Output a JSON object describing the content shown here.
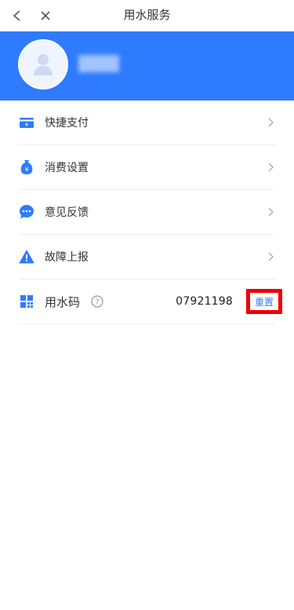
{
  "header": {
    "title": "用水服务",
    "back_icon": "back-arrow-icon",
    "close_icon": "close-icon"
  },
  "banner": {
    "color": "#2f7bff",
    "avatar_icon": "user-avatar-icon"
  },
  "menu": {
    "items": [
      {
        "label": "快捷支付",
        "icon": "payment-card-icon"
      },
      {
        "label": "消费设置",
        "icon": "money-bag-icon"
      },
      {
        "label": "意见反馈",
        "icon": "chat-bubble-icon"
      },
      {
        "label": "故障上报",
        "icon": "warning-triangle-icon"
      }
    ],
    "water_code": {
      "label": "用水码",
      "icon": "grid-code-icon",
      "help_icon": "question-circle-icon",
      "value": "07921198",
      "action_label": "重置"
    }
  },
  "colors": {
    "accent": "#2f7bff",
    "highlight": "#ee0000"
  }
}
